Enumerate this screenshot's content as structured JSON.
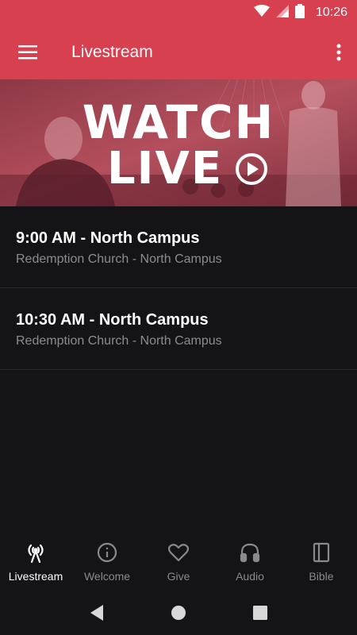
{
  "status_bar": {
    "time": "10:26"
  },
  "app_bar": {
    "title": "Livestream"
  },
  "hero": {
    "line1": "WATCH",
    "line2": "LIVE"
  },
  "streams": [
    {
      "title": "9:00 AM - North Campus",
      "subtitle": "Redemption Church - North Campus"
    },
    {
      "title": "10:30 AM - North Campus",
      "subtitle": "Redemption Church - North Campus"
    }
  ],
  "bottom_nav": [
    {
      "label": "Livestream",
      "icon": "broadcast-icon",
      "active": true
    },
    {
      "label": "Welcome",
      "icon": "info-icon",
      "active": false
    },
    {
      "label": "Give",
      "icon": "heart-icon",
      "active": false
    },
    {
      "label": "Audio",
      "icon": "headphones-icon",
      "active": false
    },
    {
      "label": "Bible",
      "icon": "book-icon",
      "active": false
    }
  ],
  "colors": {
    "accent": "#d7404e",
    "background": "#141416",
    "muted_text": "#8c8c90"
  }
}
